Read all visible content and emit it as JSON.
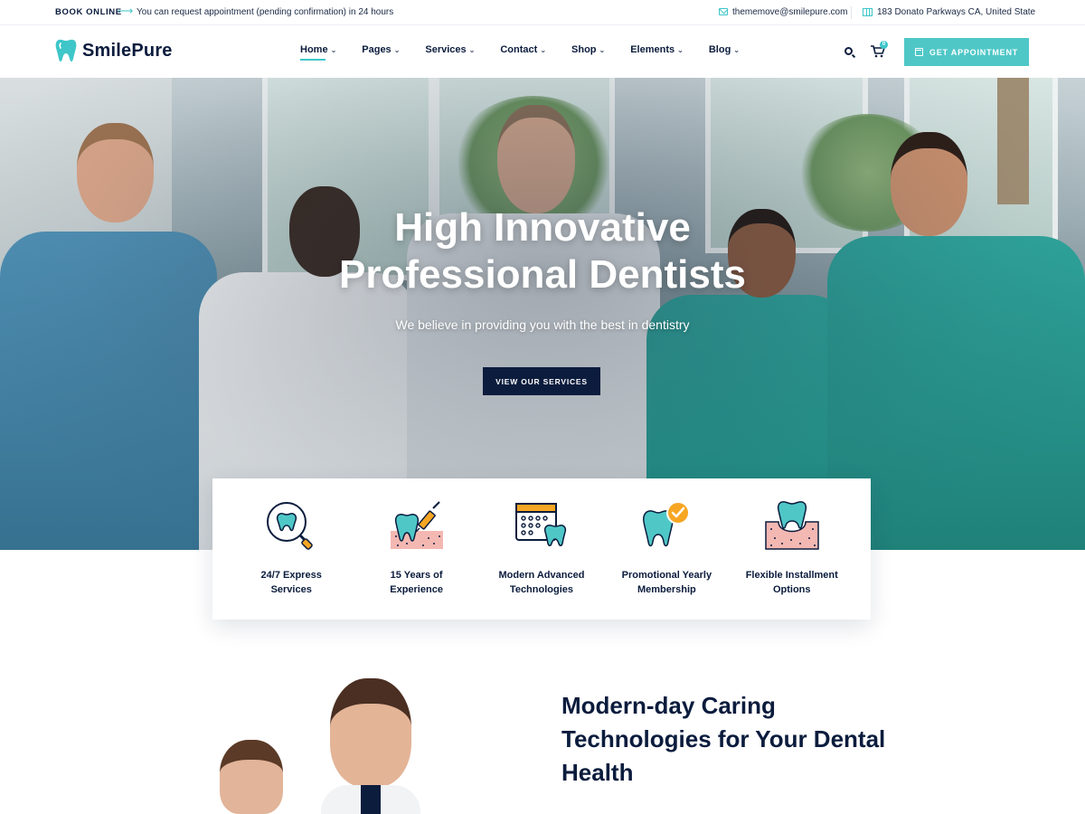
{
  "topbar": {
    "book_label": "BOOK ONLINE",
    "arrow": "⟶",
    "note": "You can request appointment (pending confirmation) in 24 hours",
    "email": "thememove@smilepure.com",
    "address": "183 Donato Parkways CA, United State"
  },
  "brand": {
    "name": "SmilePure",
    "accent": "#3ec6c9",
    "dark": "#0b1c3d"
  },
  "nav": {
    "items": [
      {
        "label": "Home",
        "chev": "⌄"
      },
      {
        "label": "Pages",
        "chev": "⌄"
      },
      {
        "label": "Services",
        "chev": "⌄"
      },
      {
        "label": "Contact",
        "chev": "⌄"
      },
      {
        "label": "Shop",
        "chev": "⌄"
      },
      {
        "label": "Elements",
        "chev": "⌄"
      },
      {
        "label": "Blog",
        "chev": "⌄"
      }
    ],
    "cart_count": "0",
    "appointment_label": "GET APPOINTMENT"
  },
  "hero": {
    "title_line1": "High Innovative",
    "title_line2": "Professional Dentists",
    "subtitle": "We believe in providing you with the best in dentistry",
    "cta": "VIEW OUR SERVICES"
  },
  "features": [
    {
      "icon": "tooth-magnifier-icon",
      "line1": "24/7 Express",
      "line2": "Services"
    },
    {
      "icon": "tooth-syringe-icon",
      "line1": "15 Years of",
      "line2": "Experience"
    },
    {
      "icon": "calendar-tooth-icon",
      "line1": "Modern Advanced",
      "line2": "Technologies"
    },
    {
      "icon": "tooth-check-icon",
      "line1": "Promotional Yearly",
      "line2": "Membership"
    },
    {
      "icon": "tooth-gum-icon",
      "line1": "Flexible Installment",
      "line2": "Options"
    }
  ],
  "about": {
    "title_line1": "Modern-day Caring",
    "title_line2": "Technologies for Your Dental",
    "title_line3": "Health"
  }
}
